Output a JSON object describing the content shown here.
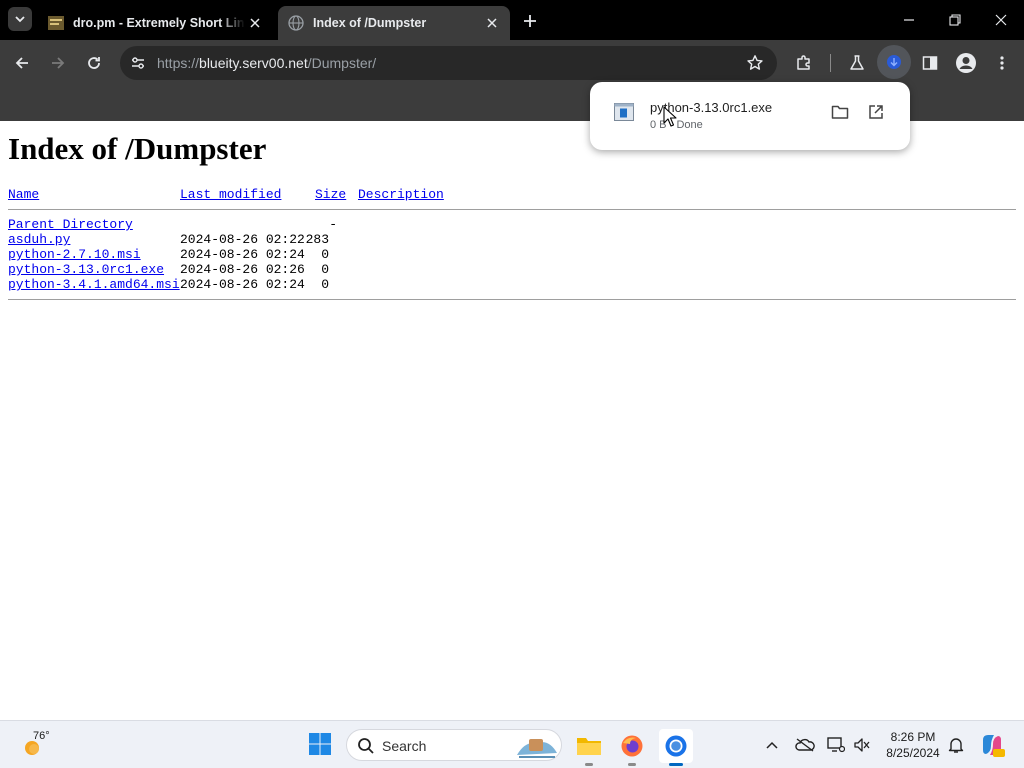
{
  "browser": {
    "tabs": [
      {
        "title": "dro.pm - Extremely Short Links",
        "active": false
      },
      {
        "title": "Index of /Dumpster",
        "active": true
      }
    ],
    "address": {
      "scheme": "https://",
      "host": "blueity.serv00.net",
      "path": "/Dumpster/"
    }
  },
  "download_bubble": {
    "filename": "python-3.13.0rc1.exe",
    "status": "0 B • Done"
  },
  "page": {
    "heading": "Index of /Dumpster",
    "columns": {
      "name": "Name",
      "last_modified": "Last modified",
      "size": "Size",
      "description": "Description"
    },
    "parent": {
      "name": "Parent Directory",
      "size": "-"
    },
    "files": [
      {
        "name": "asduh.py",
        "modified": "2024-08-26 02:22",
        "size": "283"
      },
      {
        "name": "python-2.7.10.msi",
        "modified": "2024-08-26 02:24",
        "size": "0"
      },
      {
        "name": "python-3.13.0rc1.exe",
        "modified": "2024-08-26 02:26",
        "size": "0"
      },
      {
        "name": "python-3.4.1.amd64.msi",
        "modified": "2024-08-26 02:24",
        "size": "0"
      }
    ]
  },
  "taskbar": {
    "weather_temp": "76°",
    "search_label": "Search",
    "clock_time": "8:26 PM",
    "clock_date": "8/25/2024",
    "apps": [
      "file-explorer",
      "firefox",
      "chrome"
    ]
  },
  "colors": {
    "tabstrip_bg": "#000000",
    "toolbar_bg": "#3c3c3c",
    "link": "#0000ee",
    "taskbar_accent": "#0067c0"
  }
}
